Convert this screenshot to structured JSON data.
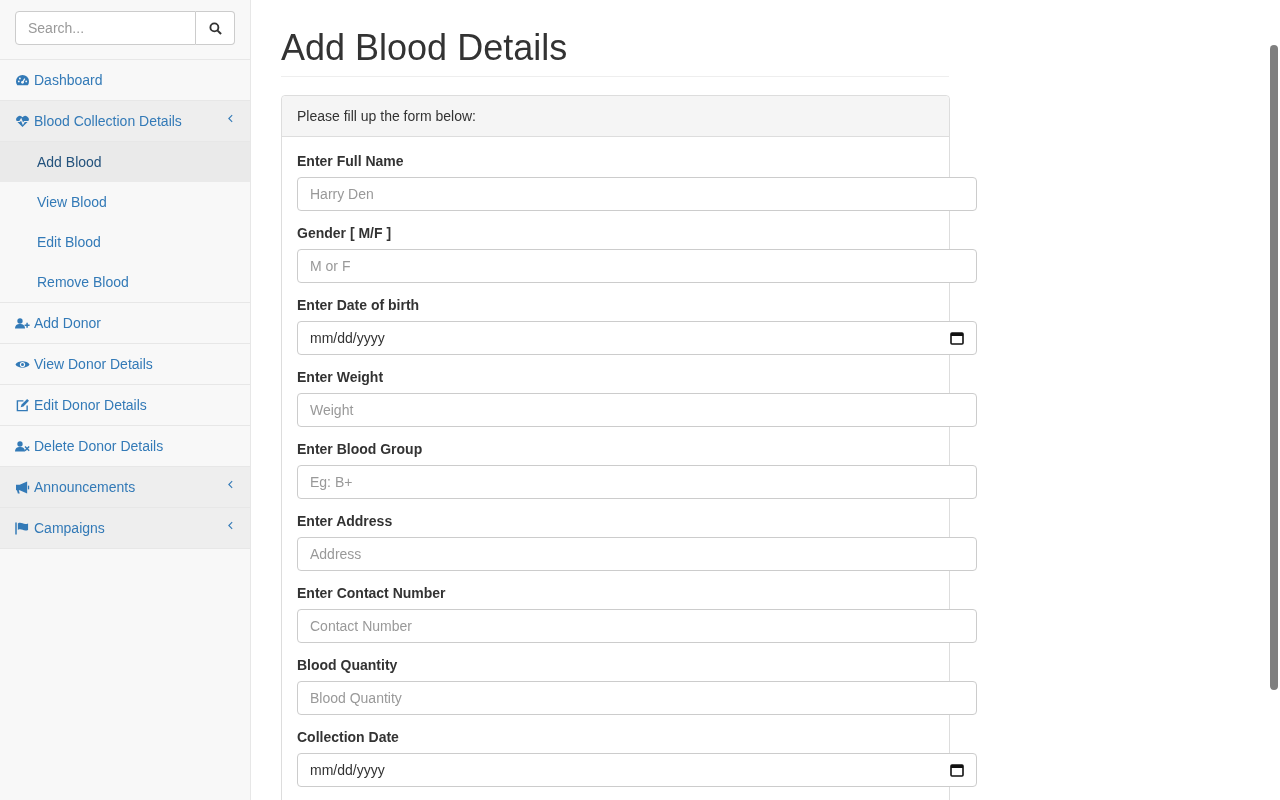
{
  "sidebar": {
    "search": {
      "placeholder": "Search..."
    },
    "items": [
      {
        "kind": "link",
        "label": "Dashboard"
      },
      {
        "kind": "group",
        "label": "Blood Collection Details",
        "children": [
          {
            "label": "Add Blood",
            "selected": true
          },
          {
            "label": "View Blood",
            "selected": false
          },
          {
            "label": "Edit Blood",
            "selected": false
          },
          {
            "label": "Remove Blood",
            "selected": false
          }
        ]
      },
      {
        "kind": "link",
        "label": "Add Donor"
      },
      {
        "kind": "link",
        "label": "View Donor Details"
      },
      {
        "kind": "link",
        "label": "Edit Donor Details"
      },
      {
        "kind": "link",
        "label": "Delete Donor Details"
      },
      {
        "kind": "group",
        "label": "Announcements"
      },
      {
        "kind": "group",
        "label": "Campaigns"
      }
    ]
  },
  "page": {
    "title": "Add Blood Details",
    "panel": {
      "heading": "Please fill up the form below:",
      "fields": [
        {
          "kind": "text",
          "label": "Enter Full Name",
          "placeholder": "Harry Den"
        },
        {
          "kind": "text",
          "label": "Gender [ M/F ]",
          "placeholder": "M or F"
        },
        {
          "kind": "date",
          "label": "Enter Date of birth",
          "placeholder": "mm/dd/yyyy"
        },
        {
          "kind": "text",
          "label": "Enter Weight",
          "placeholder": "Weight"
        },
        {
          "kind": "text",
          "label": "Enter Blood Group",
          "placeholder": "Eg: B+"
        },
        {
          "kind": "text",
          "label": "Enter Address",
          "placeholder": "Address"
        },
        {
          "kind": "text",
          "label": "Enter Contact Number",
          "placeholder": "Contact Number"
        },
        {
          "kind": "text",
          "label": "Blood Quantity",
          "placeholder": "Blood Quantity"
        },
        {
          "kind": "date",
          "label": "Collection Date",
          "placeholder": "mm/dd/yyyy"
        }
      ]
    }
  }
}
